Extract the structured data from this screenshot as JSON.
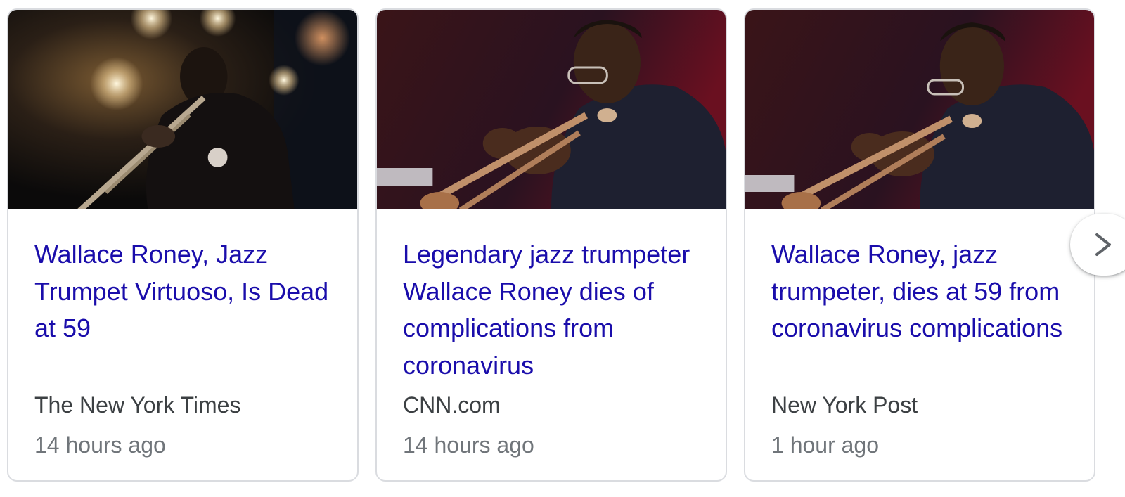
{
  "cards": [
    {
      "headline": "Wallace Roney, Jazz Trumpet Virtuoso, Is Dead at 59",
      "source": "The New York Times",
      "time": "14 hours ago"
    },
    {
      "headline": "Legendary jazz trumpeter Wallace Roney dies of complications from coronavirus",
      "source": "CNN.com",
      "time": "14 hours ago"
    },
    {
      "headline": "Wallace Roney, jazz trumpeter, dies at 59 from coronavirus complications",
      "source": "New York Post",
      "time": "1 hour ago"
    }
  ],
  "next_button": {
    "icon": "chevron-right-icon"
  },
  "colors": {
    "headline_link": "#1a0dab",
    "source_text": "#3c4043",
    "time_text": "#70757a",
    "card_border": "#dadce0"
  }
}
